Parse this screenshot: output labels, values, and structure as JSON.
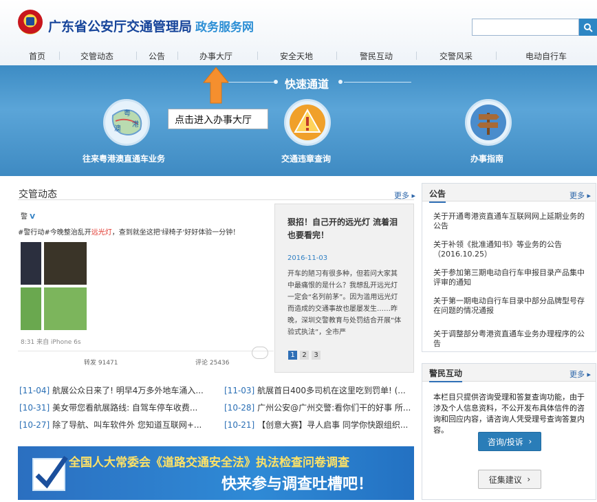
{
  "header": {
    "title": "广东省公安厅交通管理局",
    "subtitle": "政务服务网",
    "search_placeholder": ""
  },
  "nav": [
    "首页",
    "交管动态",
    "公告",
    "办事大厅",
    "安全天地",
    "警民互动",
    "交警风采",
    "电动自行车"
  ],
  "banner": {
    "quick_title": "快速通道",
    "items": [
      {
        "label": "往来粤港澳直通车业务",
        "icon": "map-icon",
        "map_labels": [
          "粤",
          "港",
          "澳"
        ]
      },
      {
        "label": "交通违章查询",
        "icon": "warning-icon"
      },
      {
        "label": "办事指南",
        "icon": "signpost-icon"
      }
    ],
    "tooltip": "点击进入办事大厅"
  },
  "news_section": {
    "title": "交管动态",
    "more": "更多",
    "weibo": {
      "caption_pre": "#警行动#今晚整治乱开",
      "caption_red": "远光灯",
      "caption_post": "，查到就坐这把'绿椅子'好好体验一分钟！",
      "meta": "8:31 来自 iPhone 6s",
      "reposts": "转发 91471",
      "comments": "评论 25436"
    },
    "feature": {
      "title": "狠招！自己开的远光灯 流着泪也要看完！",
      "date": "2016-11-03",
      "body": "开车的陋习有很多种，但若问大家其中最痛恨的是什么？我想乱开远光灯一定会“名列前茅”。因为滥用远光灯而造成的交通事故也屡屡发生……昨晚，深圳交警教育与处罚结合开展“体验式执法”，全市严"
    },
    "pager": [
      "1",
      "2",
      "3"
    ],
    "items": [
      {
        "date": "[11-04]",
        "text": "航展公众日来了! 明早4万多外地车涌入..."
      },
      {
        "date": "[11-03]",
        "text": "航展首日400多司机在这里吃到罚单! (..."
      },
      {
        "date": "[10-31]",
        "text": "美女带您看航展路线: 自驾车停车收费..."
      },
      {
        "date": "[10-28]",
        "text": "广州公安@广州交警:看你们干的好事 所..."
      },
      {
        "date": "[10-27]",
        "text": "除了导航、叫车软件外 您知道互联网+..."
      },
      {
        "date": "[10-21]",
        "text": "【创意大赛】寻人启事 同学你快跟组织..."
      }
    ]
  },
  "survey": {
    "line1": "全国人大常委会《道路交通安全法》执法检查问卷调查",
    "line2": "快来参与调查吐槽吧！"
  },
  "notice": {
    "title": "公告",
    "more": "更多",
    "items": [
      "关于开通粤港资直通车互联网网上延期业务的公告",
      "关于补领《批准通知书》等业务的公告（2016.10.25）",
      "关于参加第三期电动自行车申报目录产品集中评审的通知",
      "关于第一期电动自行车目录中部分品牌型号存在问题的情况通报",
      "关于调整部分粤港资直通车业务办理程序的公告"
    ]
  },
  "interaction": {
    "title": "警民互动",
    "more": "更多",
    "text": "本栏目只提供咨询受理和答复查询功能，由于涉及个人信息资料，不公开发布具体信件的咨询和回应内容，请咨询人凭受理号查询答复内容。",
    "btn_consult": "咨询/投诉",
    "btn_suggest": "征集建议"
  },
  "colors": {
    "brand": "#16449a",
    "accent": "#2d8fd5",
    "banner": "#4a98cf"
  }
}
